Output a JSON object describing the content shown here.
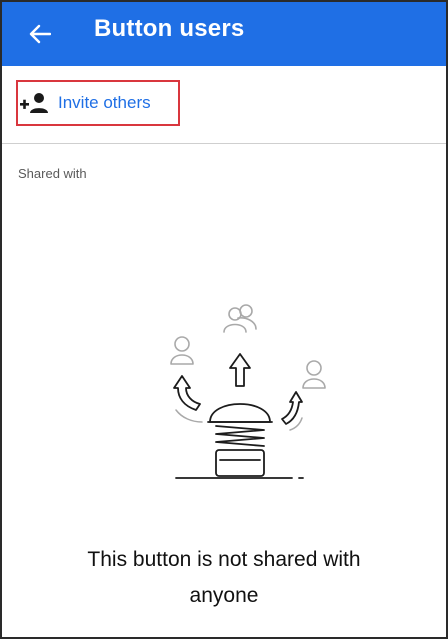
{
  "appbar": {
    "back_icon": "arrow-left-icon",
    "title": "Button users",
    "background": "#1f6fe5"
  },
  "invite": {
    "icon": "person-add-icon",
    "label": "Invite others",
    "text_color": "#1f6fe5",
    "highlight_color": "#d9363e"
  },
  "shared": {
    "label": "Shared with"
  },
  "empty_state": {
    "illustration": "button-spring-users-illustration",
    "message_line1": "This button is not shared with",
    "message_line2": "anyone"
  }
}
